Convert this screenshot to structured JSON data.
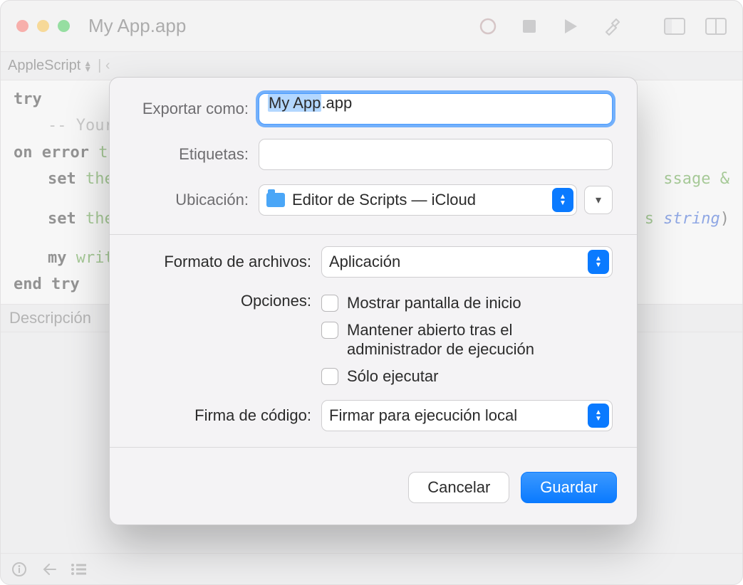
{
  "window": {
    "title": "My App.app",
    "lang_selector": "AppleScript",
    "description_label": "Descripción",
    "code_tokens": {
      "try": "try",
      "comment": "-- Your",
      "on_error": "on error",
      "the": "the",
      "set": "set",
      "ssage_amp": "ssage &",
      "s": "s",
      "string": "string",
      "paren": ")",
      "my": "my",
      "writ": "writ",
      "end_try": "end try"
    }
  },
  "dialog": {
    "labels": {
      "export_as": "Exportar como:",
      "tags": "Etiquetas:",
      "location": "Ubicación:",
      "file_format": "Formato de archivos:",
      "options": "Opciones:",
      "code_sign": "Firma de código:"
    },
    "export_as_value_sel": "My App",
    "export_as_value_rest": ".app",
    "tags_value": "",
    "location_value": "Editor de Scripts — iCloud",
    "file_format_value": "Aplicación",
    "options": {
      "show_start": "Mostrar pantalla de inicio",
      "stay_open": "Mantener abierto tras el administrador de ejecución",
      "run_only": "Sólo ejecutar"
    },
    "code_sign_value": "Firmar para ejecución local",
    "buttons": {
      "cancel": "Cancelar",
      "save": "Guardar"
    }
  }
}
